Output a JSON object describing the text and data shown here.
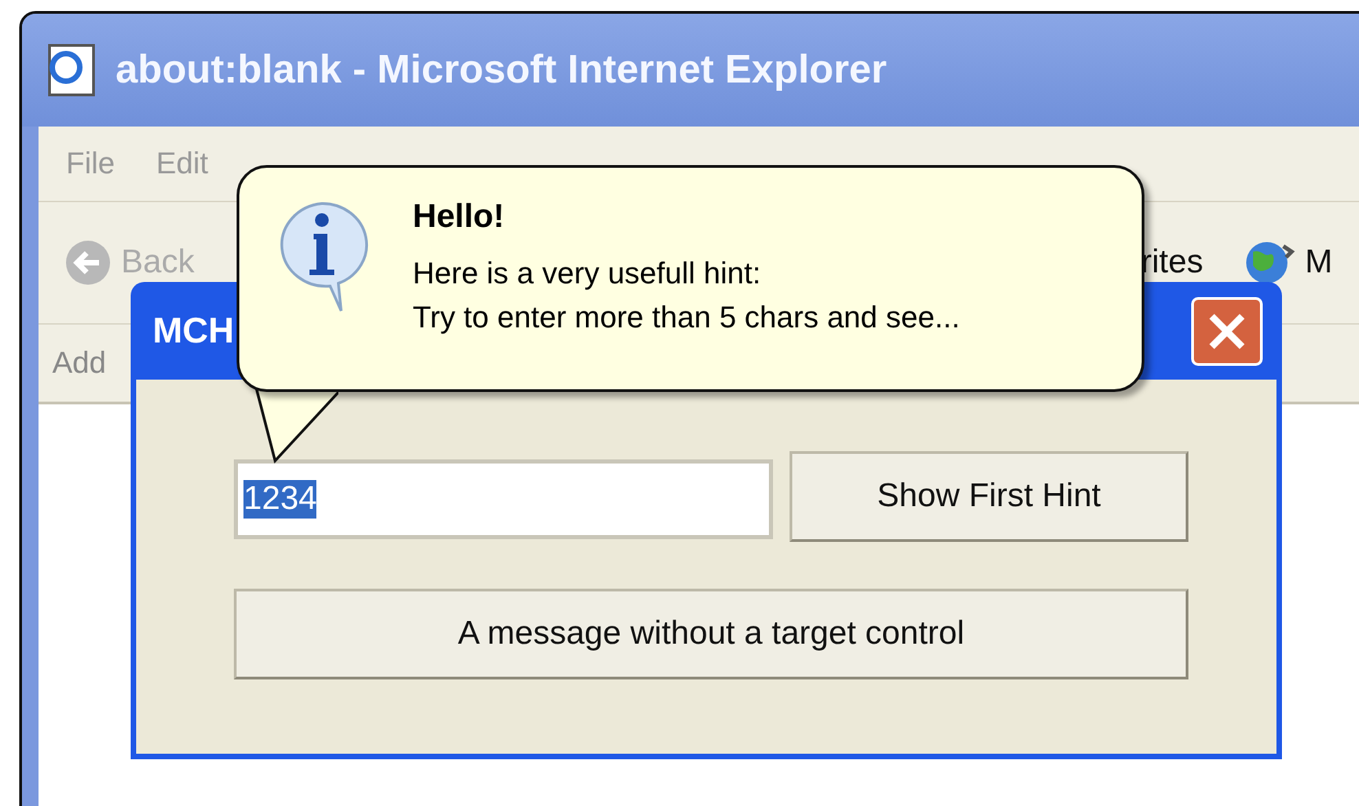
{
  "browser": {
    "title": "about:blank - Microsoft Internet Explorer",
    "menu": [
      "File",
      "Edit"
    ],
    "toolbar": [
      {
        "kind": "back",
        "label": "Back"
      },
      {
        "kind": "favorites",
        "label": "rites"
      },
      {
        "kind": "media",
        "label": "M"
      }
    ],
    "address_label": "Add"
  },
  "dialog": {
    "title": "MCH",
    "input": {
      "value": "1234",
      "selected": true
    },
    "buttons": [
      "Show First Hint",
      "A message without a target control"
    ]
  },
  "balloon": {
    "title": "Hello!",
    "lines": [
      "Here is a very usefull hint:",
      "Try to enter more than 5 chars and see..."
    ]
  }
}
